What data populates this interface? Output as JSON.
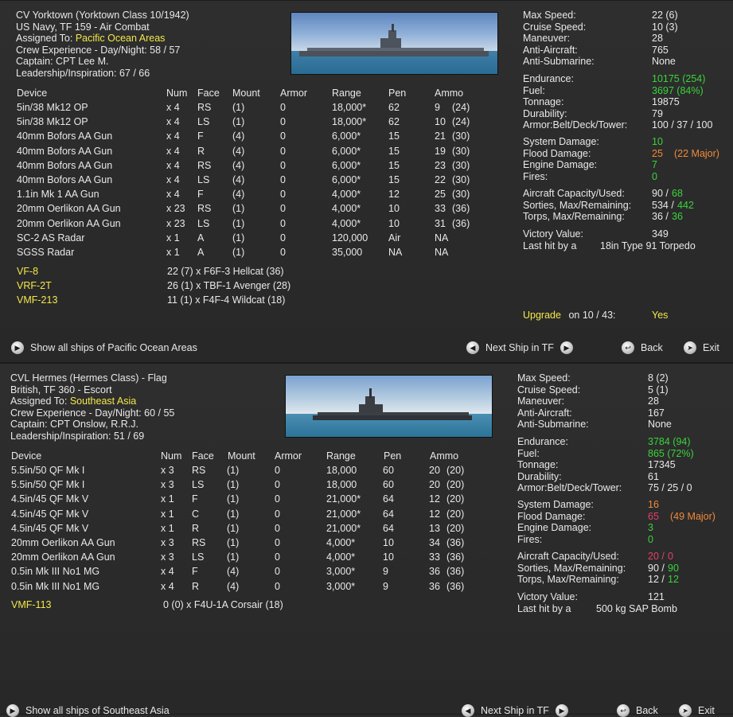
{
  "panel1": {
    "header": {
      "title": "CV Yorktown (Yorktown Class 10/1942)",
      "subtitle": "US Navy, TF 159 - Air Combat",
      "assigned_label": "Assigned To:",
      "assigned_value": "Pacific Ocean Areas",
      "crew_exp": "Crew Experience - Day/Night: 58 / 57",
      "captain": "Captain: CPT Lee M.",
      "leadership": "Leadership/Inspiration: 67 / 66"
    },
    "columns": [
      "Device",
      "Num",
      "Face",
      "Mount",
      "Armor",
      "Range",
      "Pen",
      "Ammo"
    ],
    "devices": [
      [
        "5in/38 Mk12 OP",
        "x 4",
        "RS",
        "(1)",
        "0",
        "18,000*",
        "62",
        "9",
        "(24)"
      ],
      [
        "5in/38 Mk12 OP",
        "x 4",
        "LS",
        "(1)",
        "0",
        "18,000*",
        "62",
        "10",
        "(24)"
      ],
      [
        "40mm Bofors AA Gun",
        "x 4",
        "F",
        "(4)",
        "0",
        "6,000*",
        "15",
        "21",
        "(30)"
      ],
      [
        "40mm Bofors AA Gun",
        "x 4",
        "R",
        "(4)",
        "0",
        "6,000*",
        "15",
        "19",
        "(30)"
      ],
      [
        "40mm Bofors AA Gun",
        "x 4",
        "RS",
        "(4)",
        "0",
        "6,000*",
        "15",
        "23",
        "(30)"
      ],
      [
        "40mm Bofors AA Gun",
        "x 4",
        "LS",
        "(4)",
        "0",
        "6,000*",
        "15",
        "22",
        "(30)"
      ],
      [
        "1.1in Mk 1 AA Gun",
        "x 4",
        "F",
        "(4)",
        "0",
        "4,000*",
        "12",
        "25",
        "(30)"
      ],
      [
        "20mm Oerlikon AA Gun",
        "x 23",
        "RS",
        "(1)",
        "0",
        "4,000*",
        "10",
        "33",
        "(36)"
      ],
      [
        "20mm Oerlikon AA Gun",
        "x 23",
        "LS",
        "(1)",
        "0",
        "4,000*",
        "10",
        "31",
        "(36)"
      ],
      [
        "SC-2 AS Radar",
        "x 1",
        "A",
        "(1)",
        "0",
        "120,000",
        "Air",
        "NA",
        ""
      ],
      [
        "SGSS Radar",
        "x 1",
        "A",
        "(1)",
        "0",
        "35,000",
        "NA",
        "NA",
        ""
      ]
    ],
    "air_groups": [
      {
        "name": "VF-8",
        "info": "22 (7) x F6F-3 Hellcat (36)"
      },
      {
        "name": "VRF-2T",
        "info": "26 (1) x TBF-1 Avenger (28)"
      },
      {
        "name": "VMF-213",
        "info": "11 (1) x F4F-4 Wildcat (18)"
      }
    ],
    "stats": {
      "max_speed": {
        "label": "Max Speed:",
        "value": "22 (6)"
      },
      "cruise_speed": {
        "label": "Cruise Speed:",
        "value": "10 (3)"
      },
      "maneuver": {
        "label": "Maneuver:",
        "value": "28"
      },
      "anti_aircraft": {
        "label": "Anti-Aircraft:",
        "value": "765"
      },
      "anti_sub": {
        "label": "Anti-Submarine:",
        "value": "None"
      },
      "endurance": {
        "label": "Endurance:",
        "value": "10175 (254)"
      },
      "fuel": {
        "label": "Fuel:",
        "value": "3697 (84%)"
      },
      "tonnage": {
        "label": "Tonnage:",
        "value": "19875"
      },
      "durability": {
        "label": "Durability:",
        "value": "79"
      },
      "armor": {
        "label": "Armor:Belt/Deck/Tower:",
        "value": "100 / 37 / 100"
      },
      "sys_damage": {
        "label": "System Damage:",
        "value": "10"
      },
      "flood_damage": {
        "label": "Flood Damage:",
        "value": "25",
        "extra": "(22 Major)"
      },
      "engine_damage": {
        "label": "Engine Damage:",
        "value": "7"
      },
      "fires": {
        "label": "Fires:",
        "value": "0"
      },
      "aircraft_cap": {
        "label": "Aircraft Capacity/Used:",
        "v1": "90 /",
        "v2": "68"
      },
      "sorties": {
        "label": "Sorties, Max/Remaining:",
        "v1": "534 /",
        "v2": "442"
      },
      "torps": {
        "label": "Torps, Max/Remaining:",
        "v1": "36 /",
        "v2": "36"
      },
      "victory": {
        "label": "Victory Value:",
        "value": "349"
      },
      "last_hit": {
        "label": "Last hit by a",
        "value": "18in Type 91 Torpedo"
      }
    },
    "upgrade": {
      "label": "Upgrade",
      "on": "on 10 / 43:",
      "value": "Yes"
    },
    "buttons": {
      "show_all": "Show all ships of Pacific Ocean Areas",
      "next_ship": "Next Ship in TF",
      "back": "Back",
      "exit": "Exit"
    }
  },
  "panel2": {
    "header": {
      "title": "CVL Hermes (Hermes Class) - Flag",
      "subtitle": "British, TF 360 - Escort",
      "assigned_label": "Assigned To:",
      "assigned_value": "Southeast Asia",
      "crew_exp": "Crew Experience - Day/Night: 60 / 55",
      "captain": "Captain: CPT Onslow, R.R.J.",
      "leadership": "Leadership/Inspiration: 51 / 69"
    },
    "columns": [
      "Device",
      "Num",
      "Face",
      "Mount",
      "Armor",
      "Range",
      "Pen",
      "Ammo"
    ],
    "devices": [
      [
        "5.5in/50 QF Mk I",
        "x 3",
        "RS",
        "(1)",
        "0",
        "18,000",
        "60",
        "20",
        "(20)"
      ],
      [
        "5.5in/50 QF Mk I",
        "x 3",
        "LS",
        "(1)",
        "0",
        "18,000",
        "60",
        "20",
        "(20)"
      ],
      [
        "4.5in/45 QF Mk V",
        "x 1",
        "F",
        "(1)",
        "0",
        "21,000*",
        "64",
        "12",
        "(20)"
      ],
      [
        "4.5in/45 QF Mk V",
        "x 1",
        "C",
        "(1)",
        "0",
        "21,000*",
        "64",
        "12",
        "(20)"
      ],
      [
        "4.5in/45 QF Mk V",
        "x 1",
        "R",
        "(1)",
        "0",
        "21,000*",
        "64",
        "13",
        "(20)"
      ],
      [
        "20mm Oerlikon AA Gun",
        "x 3",
        "RS",
        "(1)",
        "0",
        "4,000*",
        "10",
        "34",
        "(36)"
      ],
      [
        "20mm Oerlikon AA Gun",
        "x 3",
        "LS",
        "(1)",
        "0",
        "4,000*",
        "10",
        "33",
        "(36)"
      ],
      [
        "0.5in Mk III No1 MG",
        "x 4",
        "F",
        "(4)",
        "0",
        "3,000*",
        "9",
        "36",
        "(36)"
      ],
      [
        "0.5in Mk III No1 MG",
        "x 4",
        "R",
        "(4)",
        "0",
        "3,000*",
        "9",
        "36",
        "(36)"
      ]
    ],
    "air_groups": [
      {
        "name": "VMF-113",
        "info": "0 (0) x F4U-1A Corsair (18)"
      }
    ],
    "stats": {
      "max_speed": {
        "label": "Max Speed:",
        "value": "8 (2)"
      },
      "cruise_speed": {
        "label": "Cruise Speed:",
        "value": "5 (1)"
      },
      "maneuver": {
        "label": "Maneuver:",
        "value": "28"
      },
      "anti_aircraft": {
        "label": "Anti-Aircraft:",
        "value": "167"
      },
      "anti_sub": {
        "label": "Anti-Submarine:",
        "value": "None"
      },
      "endurance": {
        "label": "Endurance:",
        "value": "3784 (94)"
      },
      "fuel": {
        "label": "Fuel:",
        "value": "865 (72%)"
      },
      "tonnage": {
        "label": "Tonnage:",
        "value": "17345"
      },
      "durability": {
        "label": "Durability:",
        "value": "61"
      },
      "armor": {
        "label": "Armor:Belt/Deck/Tower:",
        "value": "75 / 25 / 0"
      },
      "sys_damage": {
        "label": "System Damage:",
        "value": "16"
      },
      "flood_damage": {
        "label": "Flood Damage:",
        "value": "65",
        "extra": "(49 Major)"
      },
      "engine_damage": {
        "label": "Engine Damage:",
        "value": "3"
      },
      "fires": {
        "label": "Fires:",
        "value": "0"
      },
      "aircraft_cap": {
        "label": "Aircraft Capacity/Used:",
        "v1": "20 /",
        "v2": "0"
      },
      "sorties": {
        "label": "Sorties, Max/Remaining:",
        "v1": "90 /",
        "v2": "90"
      },
      "torps": {
        "label": "Torps, Max/Remaining:",
        "v1": "12 /",
        "v2": "12"
      },
      "victory": {
        "label": "Victory Value:",
        "value": "121"
      },
      "last_hit": {
        "label": "Last hit by a",
        "value": "500 kg SAP Bomb"
      }
    },
    "buttons": {
      "show_all": "Show all ships of Southeast Asia",
      "next_ship": "Next Ship in TF",
      "back": "Back",
      "exit": "Exit"
    }
  },
  "colors": {
    "yellow": "#f2e84a",
    "green": "#39d43a",
    "orange": "#f08a3a",
    "pink": "#e0406a"
  },
  "icons": [
    "arrow-left-icon",
    "arrow-right-icon",
    "arrow-return-icon",
    "arrow-exit-icon"
  ]
}
